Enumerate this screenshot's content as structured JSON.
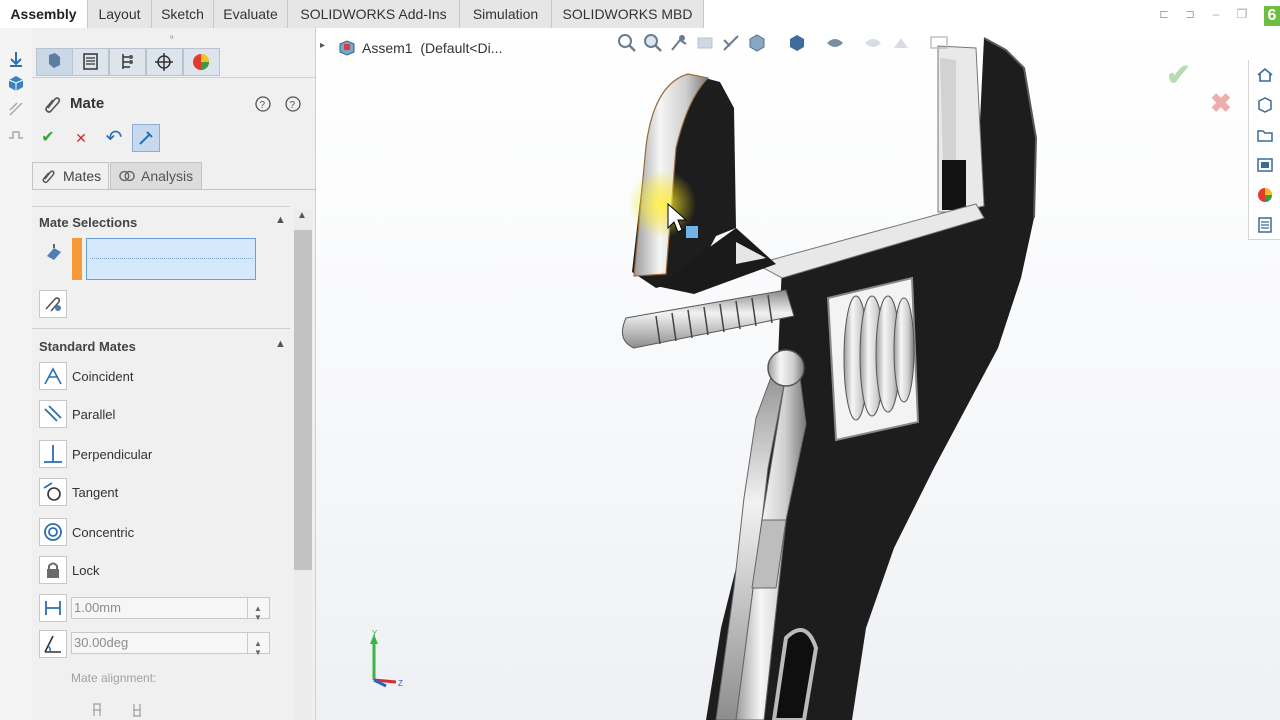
{
  "ribbon": {
    "tabs": [
      {
        "label": "Assembly",
        "active": true
      },
      {
        "label": "Layout",
        "active": false
      },
      {
        "label": "Sketch",
        "active": false
      },
      {
        "label": "Evaluate",
        "active": false
      },
      {
        "label": "SOLIDWORKS Add-Ins",
        "active": false
      },
      {
        "label": "Simulation",
        "active": false
      },
      {
        "label": "SOLIDWORKS MBD",
        "active": false
      }
    ],
    "app_logo": "6"
  },
  "property_manager": {
    "title": "Mate",
    "title_icon": "paperclip-icon",
    "help_icons": [
      "what-is-wrong-icon",
      "help-icon"
    ],
    "actions": [
      {
        "name": "ok-button",
        "icon": "checkmark-icon",
        "glyph": "✔"
      },
      {
        "name": "cancel-button",
        "icon": "close-icon",
        "glyph": "✕"
      },
      {
        "name": "undo-button",
        "icon": "undo-icon",
        "glyph": "↶"
      },
      {
        "name": "pushpin-button",
        "icon": "pushpin-icon",
        "glyph": "📌"
      }
    ],
    "sub_tabs": [
      {
        "label": "Mates",
        "active": true
      },
      {
        "label": "Analysis",
        "active": false
      }
    ],
    "mate_selections": {
      "heading": "Mate Selections",
      "entities_value": ""
    },
    "standard_mates": {
      "heading": "Standard Mates",
      "items": [
        {
          "label": "Coincident",
          "icon": "coincident-icon"
        },
        {
          "label": "Parallel",
          "icon": "parallel-icon"
        },
        {
          "label": "Perpendicular",
          "icon": "perpendicular-icon"
        },
        {
          "label": "Tangent",
          "icon": "tangent-icon"
        },
        {
          "label": "Concentric",
          "icon": "concentric-icon"
        },
        {
          "label": "Lock",
          "icon": "lock-icon"
        }
      ],
      "distance_value": "1.00mm",
      "angle_value": "30.00deg",
      "alignment_label": "Mate alignment:"
    }
  },
  "graphics": {
    "tree_root_label": "Assem1  (Default<Di...",
    "confirmation_corner": {
      "ok": "✔",
      "cancel": "✖"
    },
    "colors": {
      "accept": "#7ec27a",
      "reject": "#e06b6b",
      "model_dark": "#1e1e1e",
      "highlight": "#f5e200"
    }
  }
}
